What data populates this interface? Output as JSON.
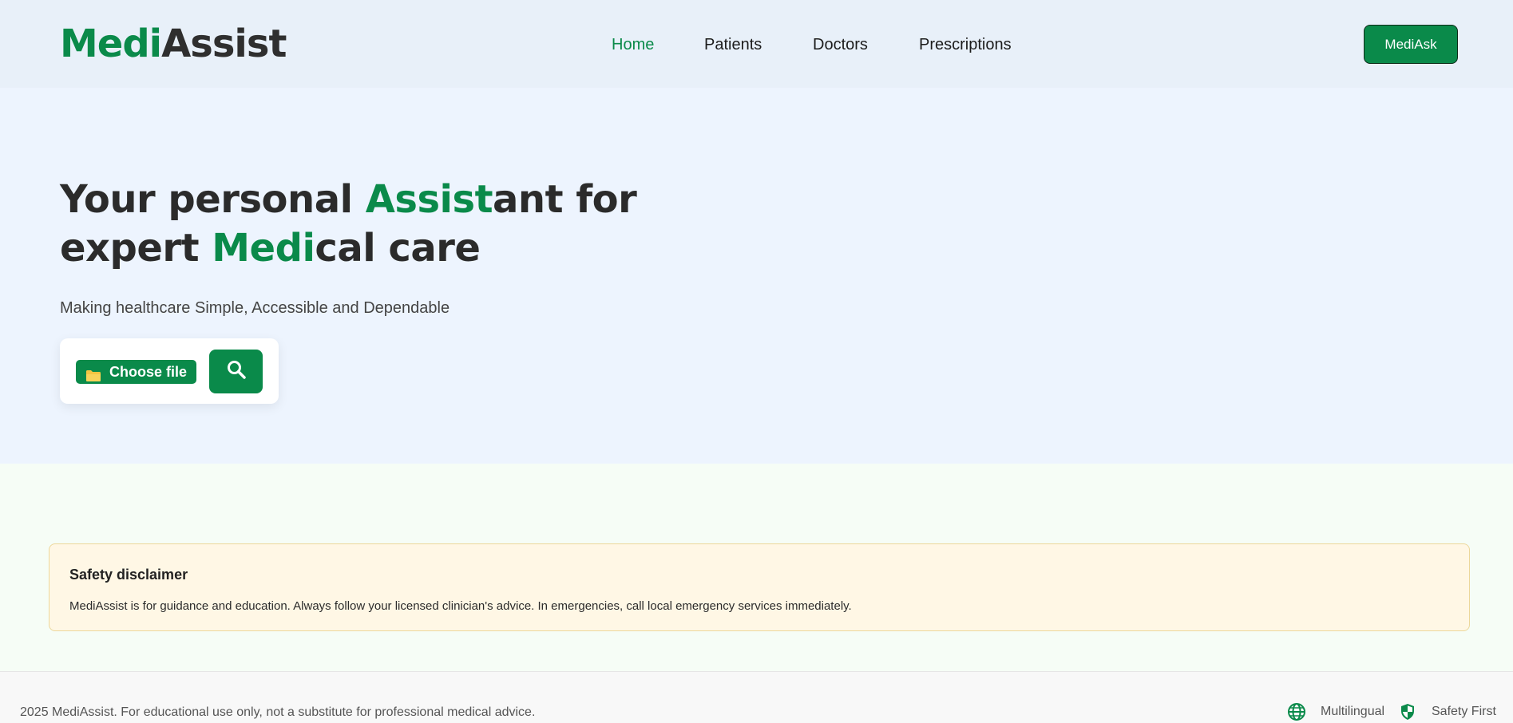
{
  "header": {
    "logo": {
      "part1": "Medi",
      "part2": "Assist"
    },
    "nav": {
      "home": "Home",
      "patients": "Patients",
      "doctors": "Doctors",
      "prescriptions": "Prescriptions"
    },
    "cta_label": "MediAsk"
  },
  "hero": {
    "title": {
      "t1": "Your personal ",
      "t2": "Assist",
      "t3": "ant for",
      "t4": "expert ",
      "t5": "Medi",
      "t6": "cal care"
    },
    "subtitle": "Making healthcare Simple, Accessible and Dependable",
    "upload": {
      "choose_label": "Choose file",
      "folder_icon": "folder-icon",
      "search_icon": "search-icon"
    }
  },
  "disclaimer": {
    "title": "Safety disclaimer",
    "text": "MediAssist is for guidance and education. Always follow your licensed clinician's advice. In emergencies, call local emergency services immediately."
  },
  "footer": {
    "copyright": "2025 MediAssist. For educational use only, not a substitute for professional medical advice.",
    "features": [
      {
        "label": "Multilingual",
        "icon": "globe-icon"
      },
      {
        "label": "Safety First",
        "icon": "shield-icon"
      }
    ]
  },
  "colors": {
    "brand_green": "#0a8a4a",
    "nav_bg": "#e8f0f9",
    "hero_bg": "#edf4fe",
    "lower_bg": "#f6fdf6",
    "disclaimer_bg": "#fff7e5"
  }
}
